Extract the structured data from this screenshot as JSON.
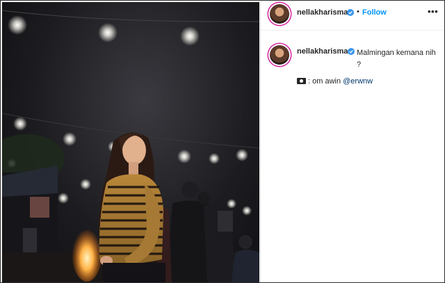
{
  "post": {
    "username": "nellakharisma",
    "follow_label": "Follow",
    "dot_separator": "•",
    "more_label": "•••",
    "caption": "Malmingan kemana nih ?",
    "credit_prefix": ": om awin",
    "credit_mention": "@erwnw"
  },
  "photo": {
    "description_icon": "photo-image"
  },
  "colors": {
    "follow_blue": "#0095f6",
    "story_ring": "#d6249f",
    "verified_blue": "#3897f0"
  }
}
